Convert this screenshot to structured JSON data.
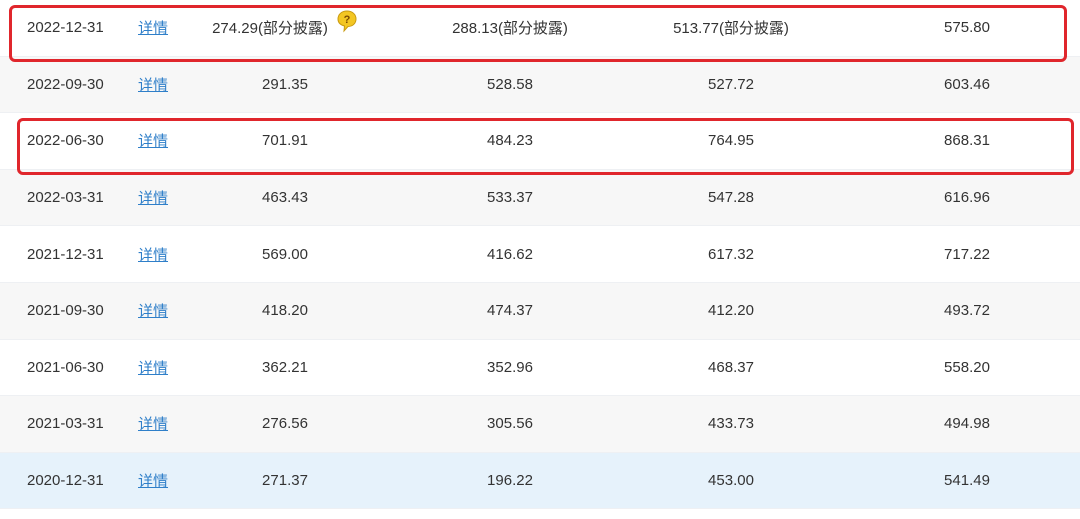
{
  "table": {
    "link_label": "详情",
    "rows": [
      {
        "date": "2022-12-31",
        "link": "详情",
        "v1": "274.29(部分披露)",
        "v2": "288.13(部分披露)",
        "v3": "513.77(部分披露)",
        "v4": "575.80"
      },
      {
        "date": "2022-09-30",
        "link": "详情",
        "v1": "291.35",
        "v2": "528.58",
        "v3": "527.72",
        "v4": "603.46"
      },
      {
        "date": "2022-06-30",
        "link": "详情",
        "v1": "701.91",
        "v2": "484.23",
        "v3": "764.95",
        "v4": "868.31"
      },
      {
        "date": "2022-03-31",
        "link": "详情",
        "v1": "463.43",
        "v2": "533.37",
        "v3": "547.28",
        "v4": "616.96"
      },
      {
        "date": "2021-12-31",
        "link": "详情",
        "v1": "569.00",
        "v2": "416.62",
        "v3": "617.32",
        "v4": "717.22"
      },
      {
        "date": "2021-09-30",
        "link": "详情",
        "v1": "418.20",
        "v2": "474.37",
        "v3": "412.20",
        "v4": "493.72"
      },
      {
        "date": "2021-06-30",
        "link": "详情",
        "v1": "362.21",
        "v2": "352.96",
        "v3": "468.37",
        "v4": "558.20"
      },
      {
        "date": "2021-03-31",
        "link": "详情",
        "v1": "276.56",
        "v2": "305.56",
        "v3": "433.73",
        "v4": "494.98"
      },
      {
        "date": "2020-12-31",
        "link": "详情",
        "v1": "271.37",
        "v2": "196.22",
        "v3": "453.00",
        "v4": "541.49"
      }
    ]
  },
  "icons": {
    "help": "question-bubble-icon"
  },
  "colors": {
    "link": "#2f7fc9",
    "highlight_box": "#e0262c",
    "row_alt_bg": "#f7f7f7",
    "row_selected_bg": "#e6f2fb",
    "help_icon_fill": "#f3c623"
  }
}
